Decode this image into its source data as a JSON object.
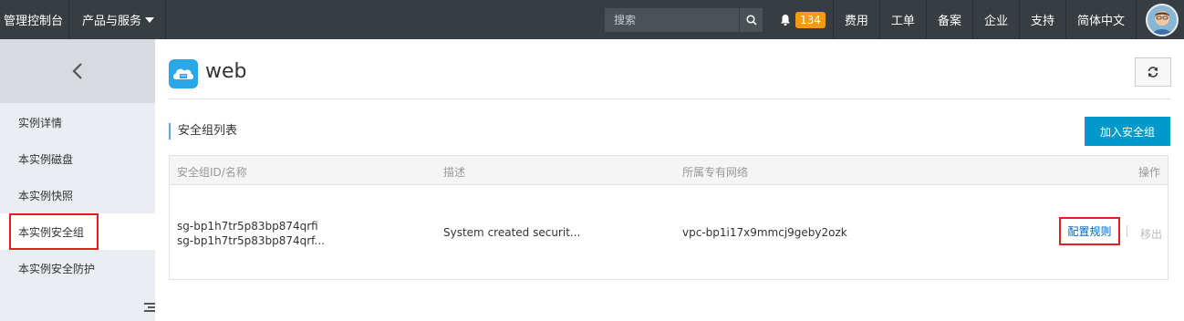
{
  "topbar": {
    "brand": "管理控制台",
    "products": "产品与服务",
    "search_placeholder": "搜索",
    "notification_count": "134",
    "links": [
      "费用",
      "工单",
      "备案",
      "企业",
      "支持",
      "简体中文"
    ]
  },
  "sidebar": {
    "items": [
      {
        "label": "实例详情"
      },
      {
        "label": "本实例磁盘"
      },
      {
        "label": "本实例快照"
      },
      {
        "label": "本实例安全组"
      },
      {
        "label": "本实例安全防护"
      }
    ]
  },
  "header": {
    "title": "web"
  },
  "section": {
    "title": "安全组列表",
    "add_button": "加入安全组"
  },
  "table": {
    "columns": [
      "安全组ID/名称",
      "描述",
      "所属专有网络",
      "操作"
    ],
    "rows": [
      {
        "id": "sg-bp1h7tr5p83bp874qrfi",
        "name": "sg-bp1h7tr5p83bp874qrf...",
        "description": "System created securit...",
        "vpc": "vpc-bp1i17x9mmcj9geby2ozk",
        "action_config": "配置规则",
        "action_remove": "移出"
      }
    ]
  },
  "colors": {
    "accent": "#0099cc",
    "highlight": "#e02020",
    "topbar": "#373d41",
    "badge": "#f39c12"
  }
}
